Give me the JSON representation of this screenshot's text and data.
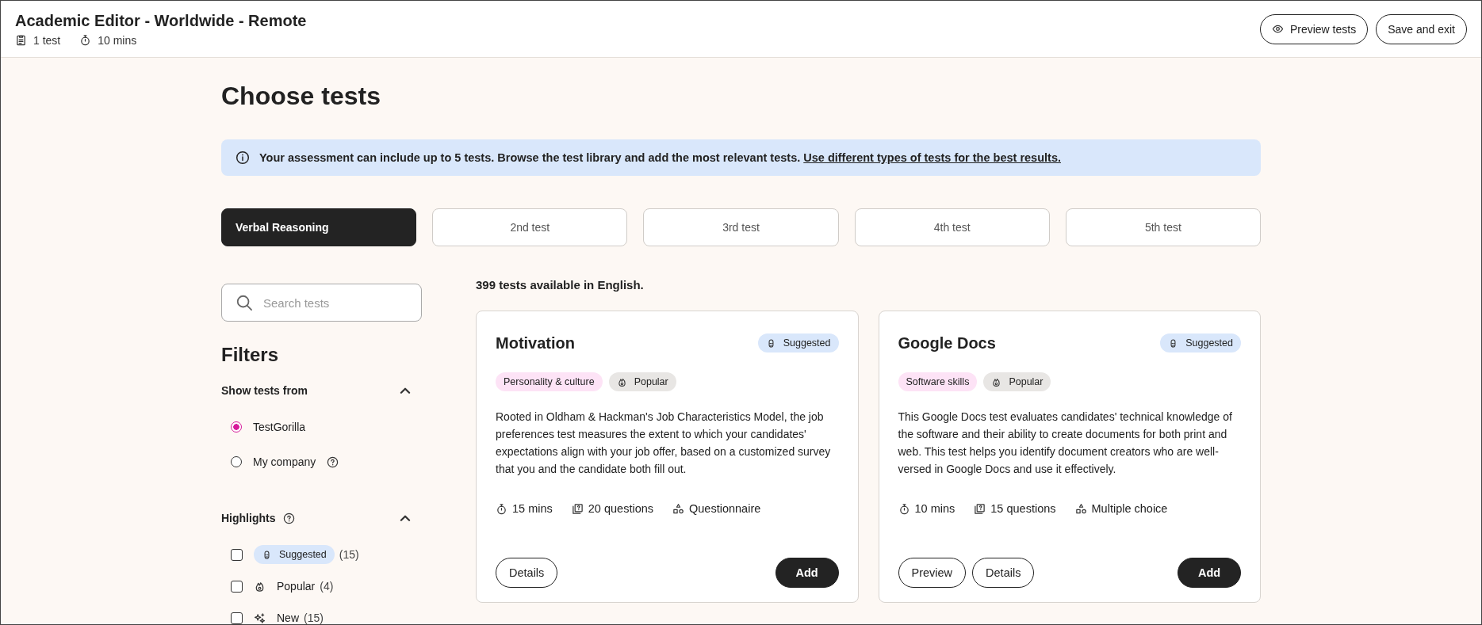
{
  "header": {
    "title": "Academic Editor - Worldwide - Remote",
    "meta": [
      {
        "kind": "tests",
        "text": "1 test"
      },
      {
        "kind": "time",
        "text": "10 mins"
      }
    ],
    "buttons": [
      {
        "kind": "preview",
        "label": "Preview tests"
      },
      {
        "kind": "plain",
        "label": "Save and exit"
      }
    ]
  },
  "page": {
    "title": "Choose tests",
    "notice": {
      "text": "Your assessment can include up to 5 tests. Browse the test library and add the most relevant tests.",
      "link": "Use different types of tests for the best results."
    },
    "slots": [
      {
        "label": "Verbal Reasoning",
        "selected": true
      },
      {
        "label": "2nd test",
        "selected": false
      },
      {
        "label": "3rd test",
        "selected": false
      },
      {
        "label": "4th test",
        "selected": false
      },
      {
        "label": "5th test",
        "selected": false
      }
    ],
    "search": {
      "placeholder": "Search tests"
    },
    "filters": {
      "title": "Filters",
      "sections": [
        {
          "title": "Show tests from",
          "help": false,
          "expanded": true,
          "options": [
            {
              "kind": "radio",
              "label": "TestGorilla",
              "help": false,
              "selected": true
            },
            {
              "kind": "radio",
              "label": "My company",
              "help": true,
              "selected": false
            }
          ]
        },
        {
          "title": "Highlights",
          "help": true,
          "expanded": true,
          "options": [
            {
              "kind": "suggested",
              "label": "Suggested",
              "count": "(15)",
              "checked": false
            },
            {
              "kind": "popular",
              "label": "Popular",
              "count": "(4)",
              "checked": false
            },
            {
              "kind": "new",
              "label": "New",
              "count": "(15)",
              "checked": false
            }
          ]
        }
      ]
    },
    "results_count": "399 tests available in English.",
    "cards": [
      {
        "title": "Motivation",
        "badge": "Suggested",
        "tags": [
          {
            "kind": "category",
            "label": "Personality & culture"
          },
          {
            "kind": "popular",
            "label": "Popular"
          }
        ],
        "description": "Rooted in Oldham & Hackman's Job Characteristics Model, the job preferences test measures the extent to which your candidates' expectations align with your job offer, based on a customized survey that you and the candidate both fill out.",
        "meta": [
          {
            "kind": "time",
            "text": "15 mins"
          },
          {
            "kind": "questions",
            "text": "20 questions"
          },
          {
            "kind": "type",
            "text": "Questionnaire"
          }
        ],
        "buttons": [
          {
            "kind": "outline",
            "label": "Details"
          },
          {
            "kind": "primary",
            "label": "Add"
          }
        ]
      },
      {
        "title": "Google Docs",
        "badge": "Suggested",
        "tags": [
          {
            "kind": "category",
            "label": "Software skills"
          },
          {
            "kind": "popular",
            "label": "Popular"
          }
        ],
        "description": "This Google Docs test evaluates candidates' technical knowledge of the software and their ability to create documents for both print and web. This test helps you identify document creators who are well-versed in Google Docs and use it effectively.",
        "meta": [
          {
            "kind": "time",
            "text": "10 mins"
          },
          {
            "kind": "questions",
            "text": "15 questions"
          },
          {
            "kind": "type",
            "text": "Multiple choice"
          }
        ],
        "buttons": [
          {
            "kind": "outline",
            "label": "Preview"
          },
          {
            "kind": "outline",
            "label": "Details"
          },
          {
            "kind": "primary",
            "label": "Add"
          }
        ]
      }
    ]
  }
}
